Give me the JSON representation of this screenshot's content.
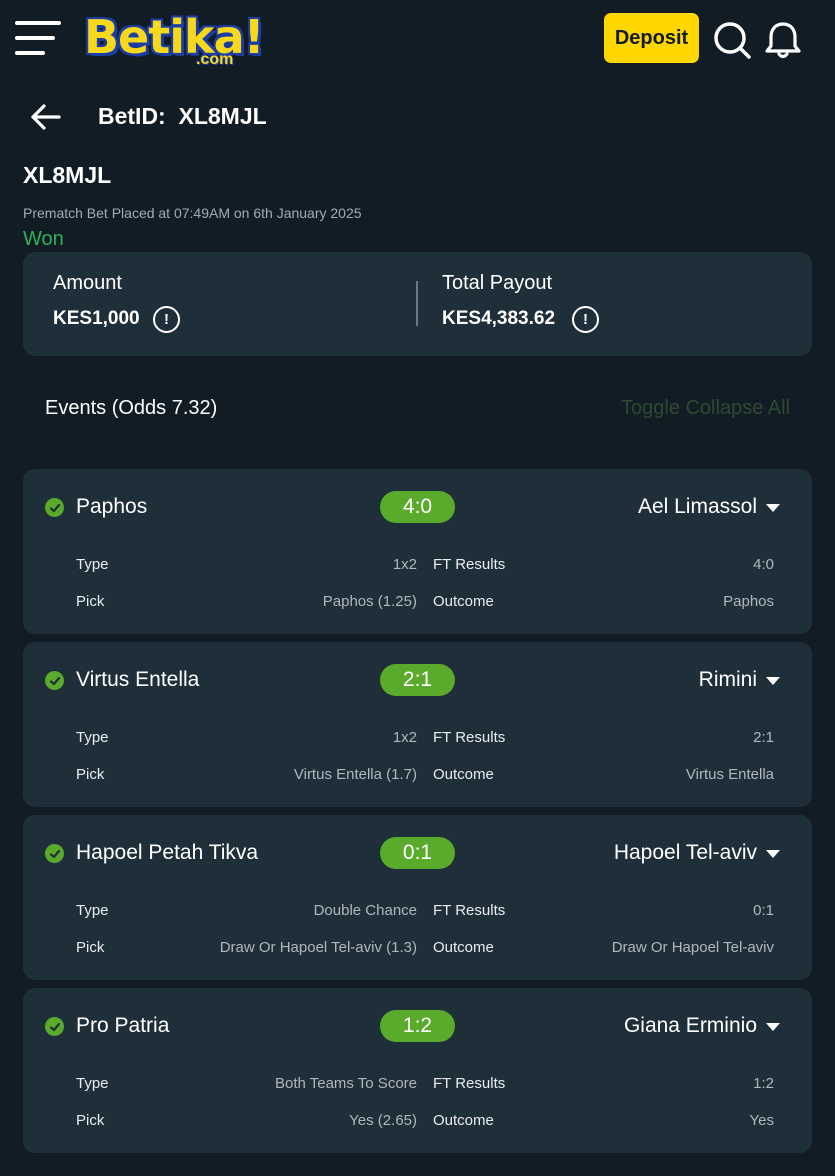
{
  "header": {
    "brand_main": "Betika!",
    "brand_sub": ".com",
    "deposit_label": "Deposit",
    "title": "BetID:  XL8MJL"
  },
  "bet": {
    "code": "XL8MJL",
    "placed": "Prematch Bet Placed at 07:49AM on 6th January 2025",
    "status": "Won",
    "amount_label": "Amount",
    "amount_value": "KES1,000",
    "payout_label": "Total Payout",
    "payout_value": "KES4,383.62",
    "info_glyph": "!"
  },
  "events_header": {
    "label": "Events (Odds 7.32)",
    "toggle_label": "Toggle Collapse All"
  },
  "field_labels": {
    "type": "Type",
    "pick": "Pick",
    "ft_results": "FT Results",
    "outcome": "Outcome"
  },
  "events": [
    {
      "home": "Paphos",
      "score": "4:0",
      "away": "Ael Limassol",
      "type": "1x2",
      "pick": "Paphos (1.25)",
      "ft_results": "4:0",
      "outcome": "Paphos"
    },
    {
      "home": "Virtus Entella",
      "score": "2:1",
      "away": "Rimini",
      "type": "1x2",
      "pick": "Virtus Entella (1.7)",
      "ft_results": "2:1",
      "outcome": "Virtus Entella"
    },
    {
      "home": "Hapoel Petah Tikva",
      "score": "0:1",
      "away": "Hapoel Tel-aviv",
      "type": "Double Chance",
      "pick": "Draw Or Hapoel Tel-aviv (1.3)",
      "ft_results": "0:1",
      "outcome": "Draw Or Hapoel Tel-aviv"
    },
    {
      "home": "Pro Patria",
      "score": "1:2",
      "away": "Giana Erminio",
      "type": "Both Teams To Score",
      "pick": "Yes (2.65)",
      "ft_results": "1:2",
      "outcome": "Yes"
    }
  ],
  "icons": [
    "menu-icon",
    "search-icon",
    "bell-icon",
    "back-arrow-icon",
    "info-icon",
    "check-icon",
    "chevron-down-icon"
  ],
  "colors": {
    "background": "#111c24",
    "card": "#1f2f3a",
    "accent_yellow": "#ffd600",
    "won_green": "#2bb35a",
    "score_green": "#5aaa2b"
  }
}
